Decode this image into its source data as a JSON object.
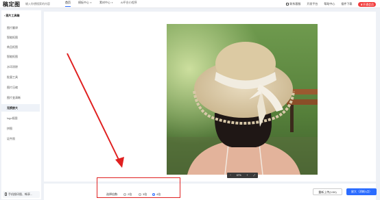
{
  "header": {
    "logo": "稿定图",
    "search_placeholder": "输入你想搜索的内容",
    "nav": [
      {
        "label": "首页",
        "active": true,
        "dropdown": false
      },
      {
        "label": "模板中心",
        "active": false,
        "dropdown": true
      },
      {
        "label": "素材中心",
        "active": false,
        "dropdown": true
      },
      {
        "label": "AI平台小程序",
        "active": false,
        "dropdown": false
      }
    ],
    "right": [
      {
        "label": "联系客服",
        "icon": "headset-icon"
      },
      {
        "label": "开发平台",
        "icon": "code-icon"
      },
      {
        "label": "帮助中心",
        "icon": "help-icon"
      },
      {
        "label": "插件下载",
        "icon": "download-icon"
      }
    ],
    "vip_label": "开通会员",
    "accent": "#f23d3d"
  },
  "sidebar": {
    "title": "图片工具箱",
    "items": [
      {
        "label": "图片翻译",
        "active": false
      },
      {
        "label": "智能抠图",
        "active": false
      },
      {
        "label": "商品抠图",
        "active": false
      },
      {
        "label": "智能抠图",
        "active": false
      },
      {
        "label": "水印消除",
        "active": false
      },
      {
        "label": "批量工具",
        "active": false
      },
      {
        "label": "图片压缩",
        "active": false
      },
      {
        "label": "图片变清晰",
        "active": false
      },
      {
        "label": "无损放大",
        "active": true
      },
      {
        "label": "logo抠图",
        "active": false
      },
      {
        "label": "拼图",
        "active": false
      },
      {
        "label": "证件照",
        "active": false
      }
    ],
    "footer": "手机搜印图、畅享..."
  },
  "canvas": {
    "zoom": "67%",
    "zoom_minus": "−",
    "zoom_plus": "+",
    "fullscreen": "⤢"
  },
  "bottom": {
    "option_label": "选择倍数:",
    "scales": [
      {
        "label": "2倍",
        "checked": false
      },
      {
        "label": "3倍",
        "checked": false
      },
      {
        "label": "4倍",
        "checked": true
      }
    ],
    "reupload_label": "重新上传(1/30)",
    "enlarge_label": "放大（消耗1点）",
    "primary_color": "#2b6cff"
  },
  "annotation": {
    "color": "#e02020"
  }
}
